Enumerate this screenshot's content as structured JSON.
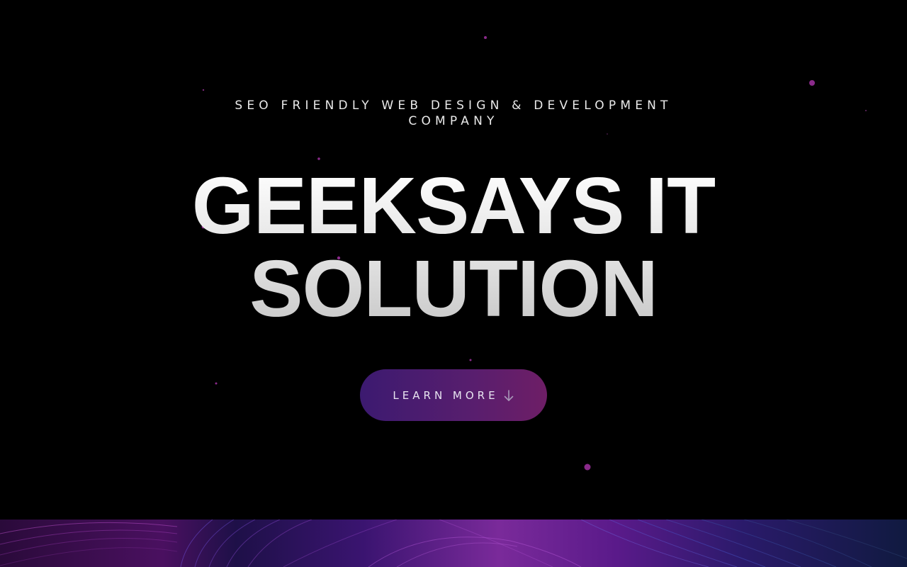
{
  "hero": {
    "tagline": "SEO FRIENDLY WEB DESIGN & DEVELOPMENT COMPANY",
    "headline_line1": "GEEKSAYS IT",
    "headline_line2": "SOLUTION",
    "cta_label": "LEARN MORE",
    "cta_icon": "arrow-down-icon"
  },
  "colors": {
    "background": "#000000",
    "particle": "#8a2a8a",
    "cta_start": "#3c1a70",
    "cta_end": "#6e1e66",
    "band_accent": "#7a2a9a"
  }
}
